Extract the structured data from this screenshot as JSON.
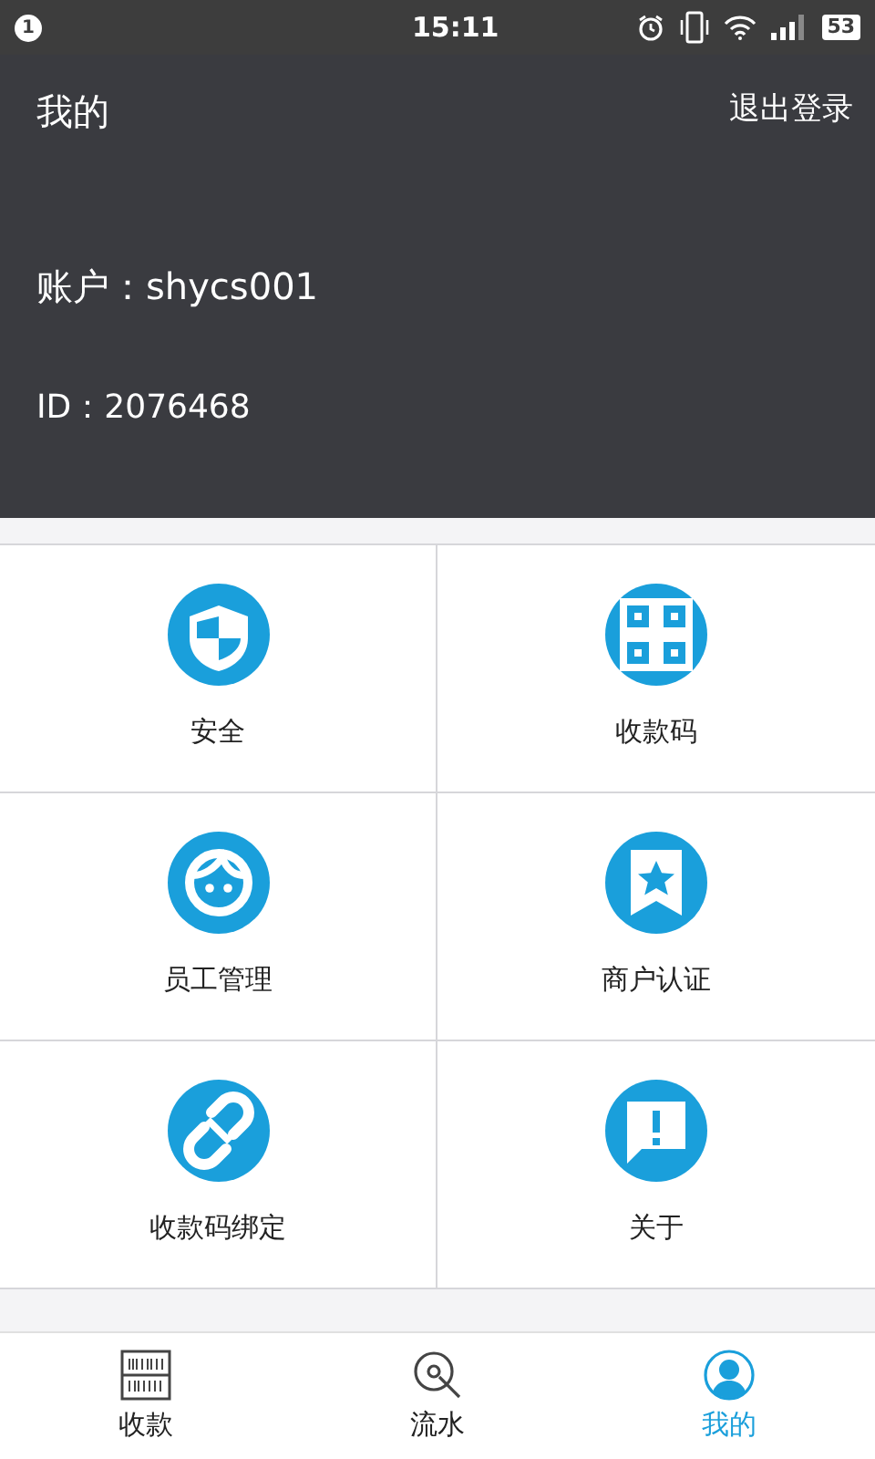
{
  "status_bar": {
    "notification_count": "1",
    "time": "15:11",
    "battery": "53"
  },
  "header": {
    "title": "我的",
    "logout": "退出登录",
    "account": "账户：shycs001",
    "id": "ID：2076468"
  },
  "menu": [
    {
      "kind": "shield",
      "label": "安全"
    },
    {
      "kind": "qr",
      "label": "收款码"
    },
    {
      "kind": "face",
      "label": "员工管理"
    },
    {
      "kind": "badge",
      "label": "商户认证"
    },
    {
      "kind": "link",
      "label": "收款码绑定"
    },
    {
      "kind": "info",
      "label": "关于"
    }
  ],
  "tabs": [
    {
      "kind": "barcode",
      "label": "收款",
      "selected": false
    },
    {
      "kind": "search",
      "label": "流水",
      "selected": false
    },
    {
      "kind": "person",
      "label": "我的",
      "selected": true
    }
  ]
}
